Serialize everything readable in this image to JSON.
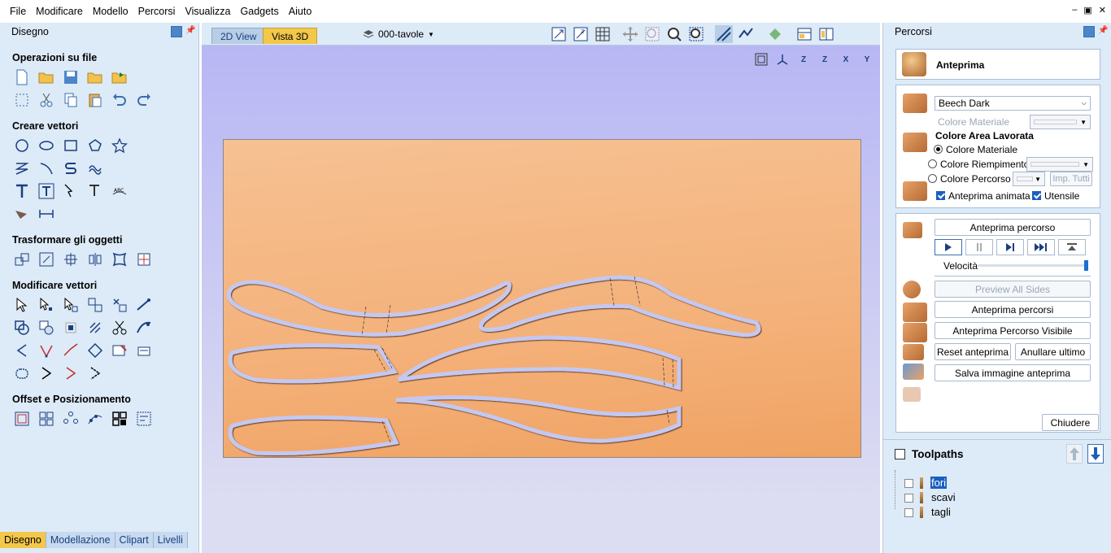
{
  "menu": [
    "File",
    "Modificare",
    "Modello",
    "Percorsi",
    "Visualizza",
    "Gadgets",
    "Aiuto"
  ],
  "window_controls": [
    "‒",
    "▣",
    "✕"
  ],
  "left_panel": {
    "title": "Disegno",
    "sections": {
      "file": "Operazioni su file",
      "create": "Creare vettori",
      "transform": "Trasformare gli oggetti",
      "modify": "Modificare vettori",
      "offset": "Offset e Posizionamento"
    },
    "tabs": [
      "Disegno",
      "Modellazione",
      "Clipart",
      "Livelli"
    ]
  },
  "view": {
    "tabs": [
      "2D View",
      "Vista 3D"
    ],
    "active_tab": "Vista 3D",
    "layer": "000-tavole",
    "axes": [
      "Z",
      "Z",
      "X",
      "Y"
    ]
  },
  "right_panel": {
    "title": "Percorsi",
    "preview_title": "Anteprima",
    "material": "Beech Dark",
    "material_color_label": "Colore Materiale",
    "area_heading": "Colore Area Lavorata",
    "radio_material": "Colore Materiale",
    "radio_fill": "Colore Riempimento",
    "radio_path": "Colore Percorso",
    "imp_all": "Imp. Tutti",
    "animated": "Anteprima animata",
    "tool": "Utensile",
    "preview_path_btn": "Anteprima percorso",
    "speed_label": "Velocità",
    "speed_value": 1.0,
    "preview_all_sides": "Preview All Sides",
    "preview_paths": "Anteprima percorsi",
    "preview_visible": "Anteprima Percorso Visibile",
    "reset": "Reset anteprima",
    "undo_last": "Anullare ultimo",
    "save_image": "Salva immagine anteprima",
    "close": "Chiudere"
  },
  "toolpaths": {
    "title": "Toolpaths",
    "items": [
      "fori",
      "scavi",
      "tagli"
    ]
  }
}
